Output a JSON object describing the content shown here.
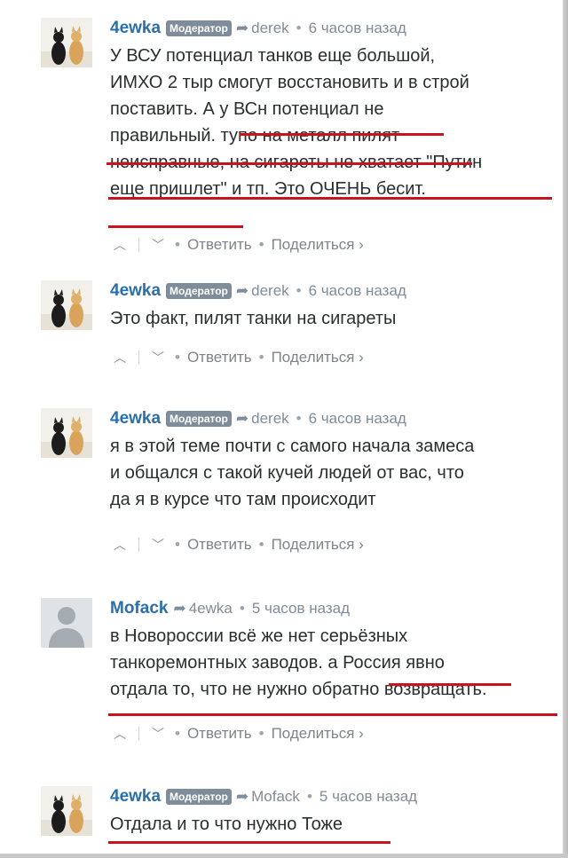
{
  "comments": [
    {
      "author": "4ewka",
      "badge": "Модератор",
      "reply_to": "derek",
      "time": "6 часов назад",
      "lines": [
        "У ВСУ потенциал танков еще большой,",
        "ИМХО 2 тыр смогут восстановить и в строй",
        "поставить. А у ВСн потенциал не",
        "правильный. тупо на металл пилят",
        "неисправные, на сигареты не хватает \"Путин",
        "еще пришлет\" и тп. Это ОЧЕНЬ бесит."
      ],
      "actions": {
        "reply": "Ответить",
        "share": "Поделиться ›"
      },
      "avatar_icon": "cats-avatar-icon"
    },
    {
      "author": "4ewka",
      "badge": "Модератор",
      "reply_to": "derek",
      "time": "6 часов назад",
      "lines": [
        "Это факт, пилят танки на сигареты"
      ],
      "actions": {
        "reply": "Ответить",
        "share": "Поделиться ›"
      },
      "avatar_icon": "cats-avatar-icon"
    },
    {
      "author": "4ewka",
      "badge": "Модератор",
      "reply_to": "derek",
      "time": "6 часов назад",
      "lines": [
        "я в этой теме почти с самого начала замеса",
        "и общался с такой кучей людей от вас, что",
        "да я в курсе что там происходит"
      ],
      "actions": {
        "reply": "Ответить",
        "share": "Поделиться ›"
      },
      "avatar_icon": "cats-avatar-icon"
    },
    {
      "author": "Mofack",
      "reply_to": "4ewka",
      "time": "5 часов назад",
      "lines": [
        "в Новороссии всё же нет серьёзных",
        "танкоремонтных заводов. а Россия явно",
        "отдала то, что не нужно обратно возвращать."
      ],
      "actions": {
        "reply": "Ответить",
        "share": "Поделиться ›"
      },
      "avatar_icon": "default-user-avatar-icon"
    },
    {
      "author": "4ewka",
      "badge": "Модератор",
      "reply_to": "Mofack",
      "time": "5 часов назад",
      "lines": [
        "Отдала и то что нужно Тоже"
      ],
      "avatar_icon": "cats-avatar-icon"
    }
  ],
  "icons": {
    "reply_arrow": "➦",
    "upvote": "︿",
    "downvote": "﹀"
  },
  "colors": {
    "author": "#2a6fa8",
    "badge_bg": "#7f8c99",
    "underline": "#c8141e",
    "meta": "#7f8c99"
  }
}
